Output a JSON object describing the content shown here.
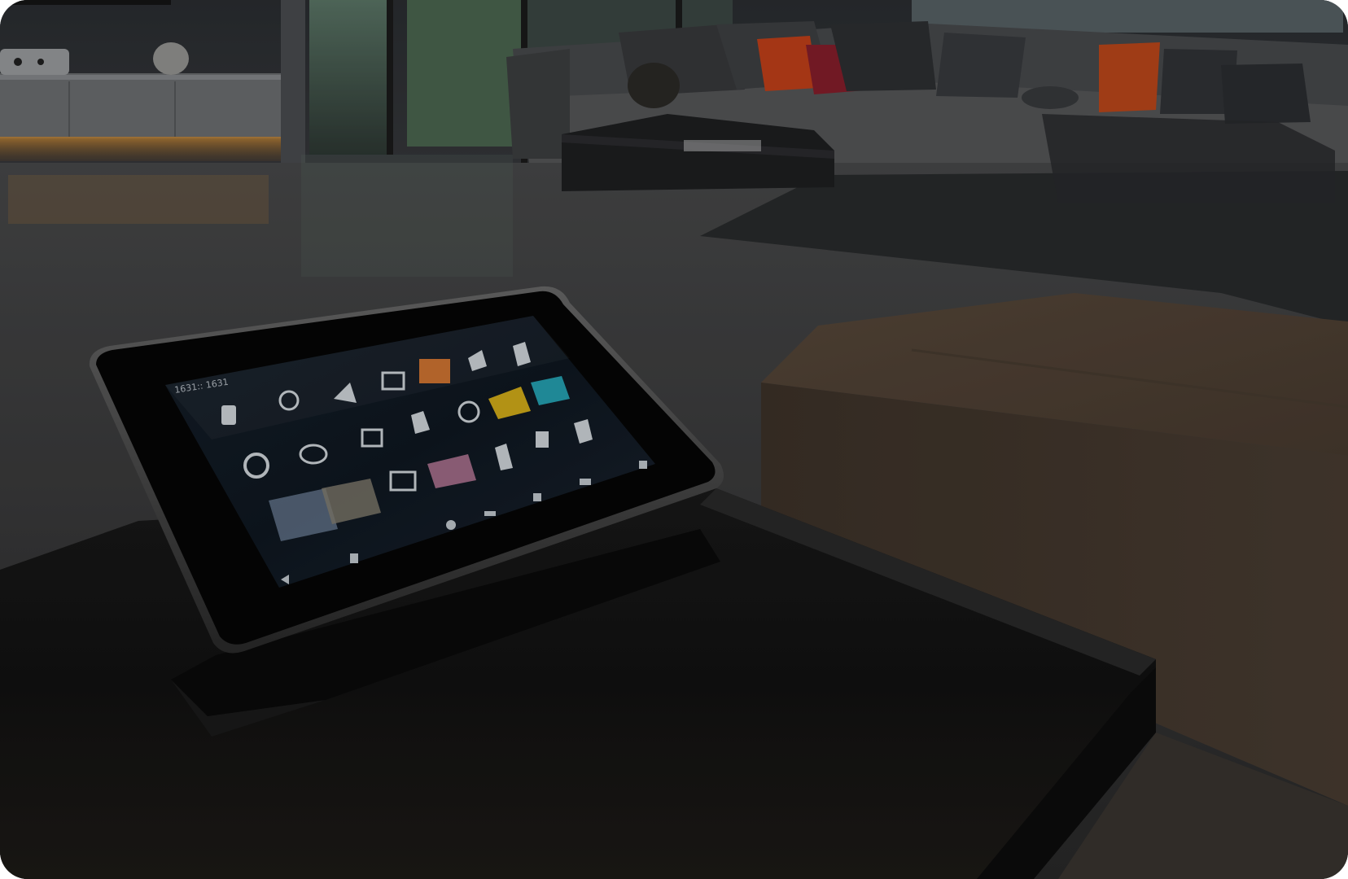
{
  "scene": {
    "description_free": true,
    "accent_colors": {
      "screen_yellow": "#d9b21a",
      "screen_cyan": "#27a7b8",
      "screen_orange": "#d7742c",
      "pillow_orange": "#c9421a",
      "pillow_red": "#8a1f2c",
      "led_strip": "#c98b3a"
    }
  },
  "tablet": {
    "status_text": "1631:: 1631",
    "tile_icons": [
      "device-icon",
      "network-icon",
      "plant-icon",
      "picture-icon",
      "photo-icon",
      "fork-icon",
      "bottle-icon",
      "ring-icon",
      "shower-icon",
      "monitor-icon",
      "robot-icon",
      "face-icon",
      "sun-icon",
      "weather-icon",
      "shirt-icon",
      "hand-icon",
      "gallery-icon",
      "media-icon",
      "hand2-icon"
    ],
    "nav_icons": [
      "back-icon",
      "home-icon",
      "recent-icon",
      "menu-icon",
      "link-icon",
      "cast-icon",
      "settings-icon"
    ]
  }
}
